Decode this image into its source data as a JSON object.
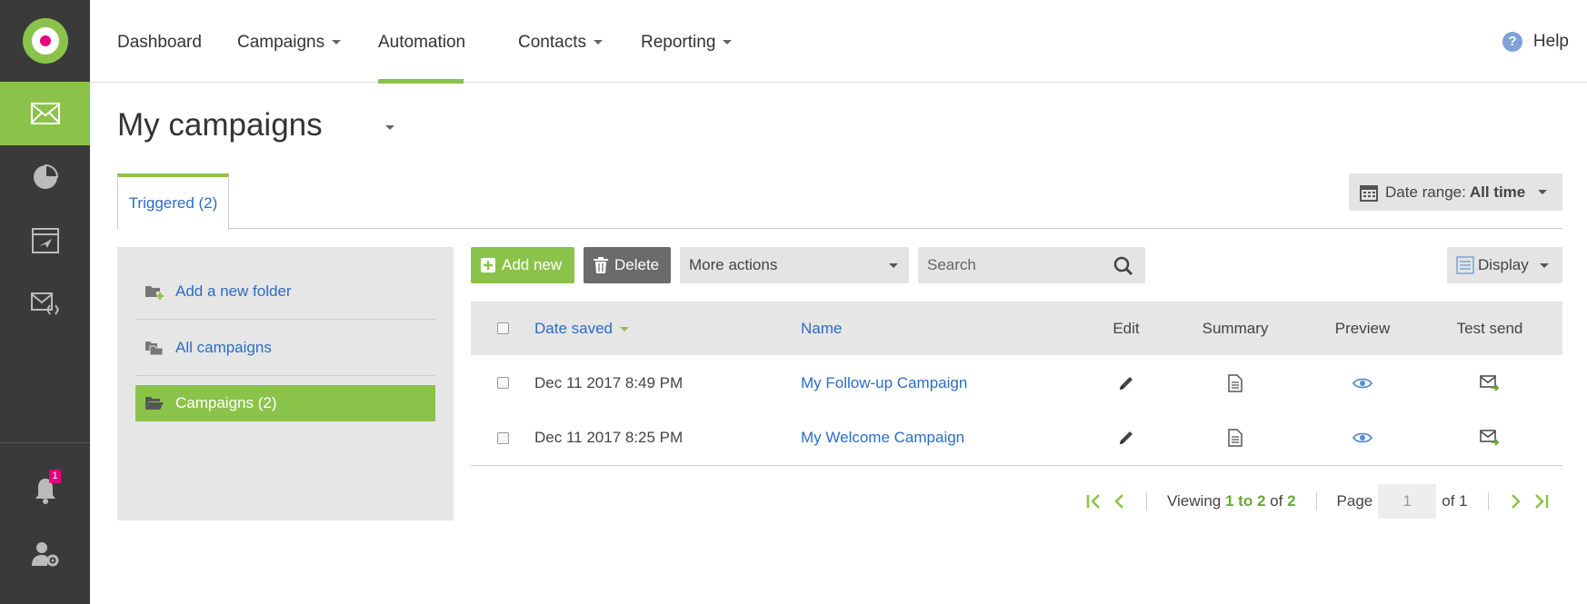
{
  "nav": {
    "dashboard": "Dashboard",
    "campaigns": "Campaigns",
    "automation": "Automation",
    "contacts": "Contacts",
    "reporting": "Reporting",
    "help": "Help"
  },
  "sidebar": {
    "notification_count": "1"
  },
  "page": {
    "title": "My campaigns"
  },
  "tabs": [
    {
      "label": "Triggered (2)"
    }
  ],
  "date_range": {
    "label": "Date range:",
    "value": "All time"
  },
  "folders": {
    "add": "Add a new folder",
    "all": "All campaigns",
    "selected": "Campaigns (2)"
  },
  "toolbar": {
    "add_new": "Add new",
    "delete": "Delete",
    "more_actions": "More actions",
    "search_placeholder": "Search",
    "display": "Display"
  },
  "table": {
    "headers": {
      "date_saved": "Date saved",
      "name": "Name",
      "edit": "Edit",
      "summary": "Summary",
      "preview": "Preview",
      "test_send": "Test send"
    },
    "rows": [
      {
        "date": "Dec 11 2017 8:49 PM",
        "name": "My Follow-up Campaign"
      },
      {
        "date": "Dec 11 2017 8:25 PM",
        "name": "My Welcome Campaign"
      }
    ]
  },
  "pager": {
    "viewing": "Viewing",
    "range_start": "1",
    "to": "to",
    "range_end": "2",
    "of": "of",
    "total": "2",
    "page_label": "Page",
    "page_value": "1",
    "of_pages": "of 1"
  },
  "colors": {
    "accent": "#8bc34a",
    "sidebar": "#3a3a3a",
    "link": "#2b6cc4",
    "badge": "#e5007e"
  }
}
